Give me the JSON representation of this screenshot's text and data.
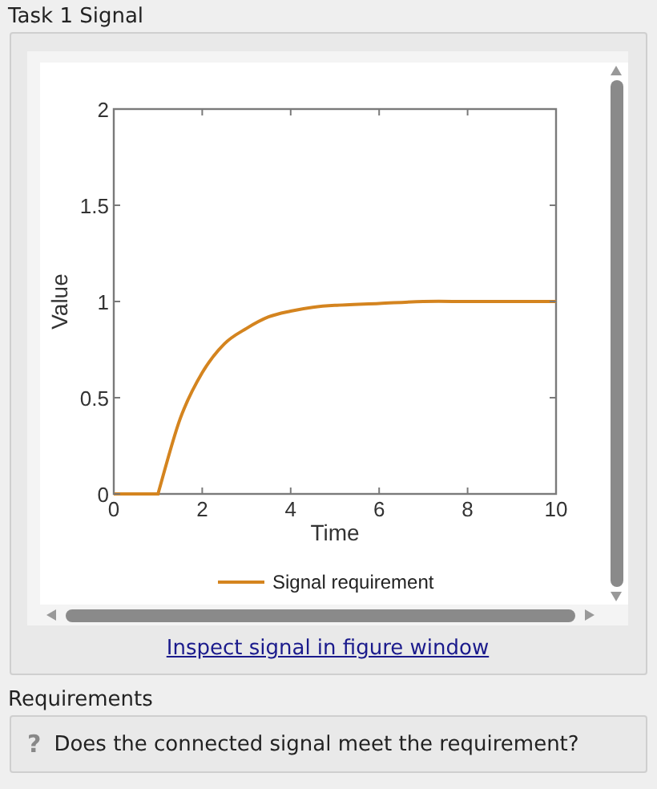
{
  "panel": {
    "title": "Task 1 Signal"
  },
  "figure": {
    "chart_data": {
      "type": "line",
      "xlabel": "Time",
      "ylabel": "Value",
      "x": [
        0,
        1,
        1.5,
        2,
        2.5,
        3,
        3.5,
        4,
        4.5,
        5,
        6,
        7,
        8,
        9,
        10
      ],
      "series": [
        {
          "name": "Signal requirement",
          "color": "#d4841f",
          "values": [
            0,
            0,
            0.39,
            0.63,
            0.78,
            0.86,
            0.92,
            0.95,
            0.97,
            0.98,
            0.99,
            1,
            1,
            1,
            1
          ]
        }
      ],
      "xlim": [
        0,
        10
      ],
      "ylim": [
        0,
        2
      ],
      "xticks": [
        0,
        2,
        4,
        6,
        8,
        10
      ],
      "yticks": [
        0,
        0.5,
        1,
        1.5,
        2
      ]
    }
  },
  "link": "Inspect signal in figure window",
  "requirements": {
    "title": "Requirements",
    "items": [
      {
        "icon": "?",
        "text": "Does the connected signal meet the requirement?"
      }
    ]
  }
}
